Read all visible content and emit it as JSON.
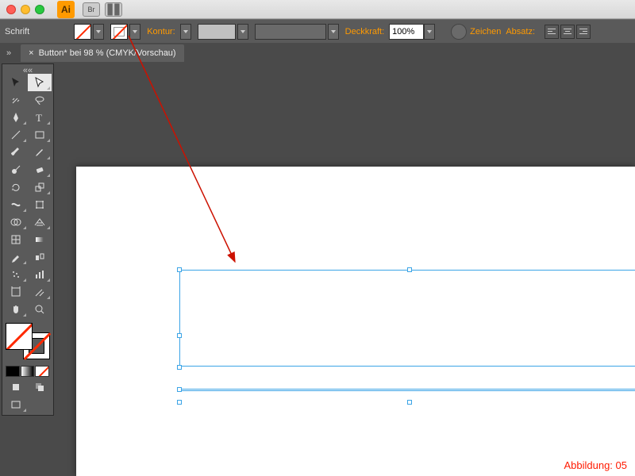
{
  "titlebar": {
    "app_abbrev": "Ai",
    "br_label": "Br"
  },
  "controlbar": {
    "schrift_label": "Schrift",
    "kontur_label": "Kontur:",
    "deckkraft_label": "Deckkraft:",
    "opacity_value": "100%",
    "zeichen_label": "Zeichen",
    "absatz_label": "Absatz:"
  },
  "document_tab": {
    "title": "Button* bei 98 % (CMYK/Vorschau)"
  },
  "tools": [
    [
      "selection",
      "direct-selection"
    ],
    [
      "magic-wand",
      "lasso"
    ],
    [
      "pen",
      "type"
    ],
    [
      "line",
      "rectangle"
    ],
    [
      "paintbrush",
      "pencil"
    ],
    [
      "blob-brush",
      "eraser"
    ],
    [
      "rotate",
      "scale"
    ],
    [
      "width",
      "free-transform"
    ],
    [
      "shape-builder",
      "perspective"
    ],
    [
      "mesh",
      "gradient"
    ],
    [
      "eyedropper",
      "blend"
    ],
    [
      "symbol-spray",
      "column-graph"
    ],
    [
      "artboard",
      "slice"
    ],
    [
      "hand",
      "zoom"
    ]
  ],
  "caption": "Abbildung: 05",
  "colors": {
    "accent": "#ff9a00",
    "selection": "#3ba4e6",
    "annotation": "#cc1100"
  }
}
